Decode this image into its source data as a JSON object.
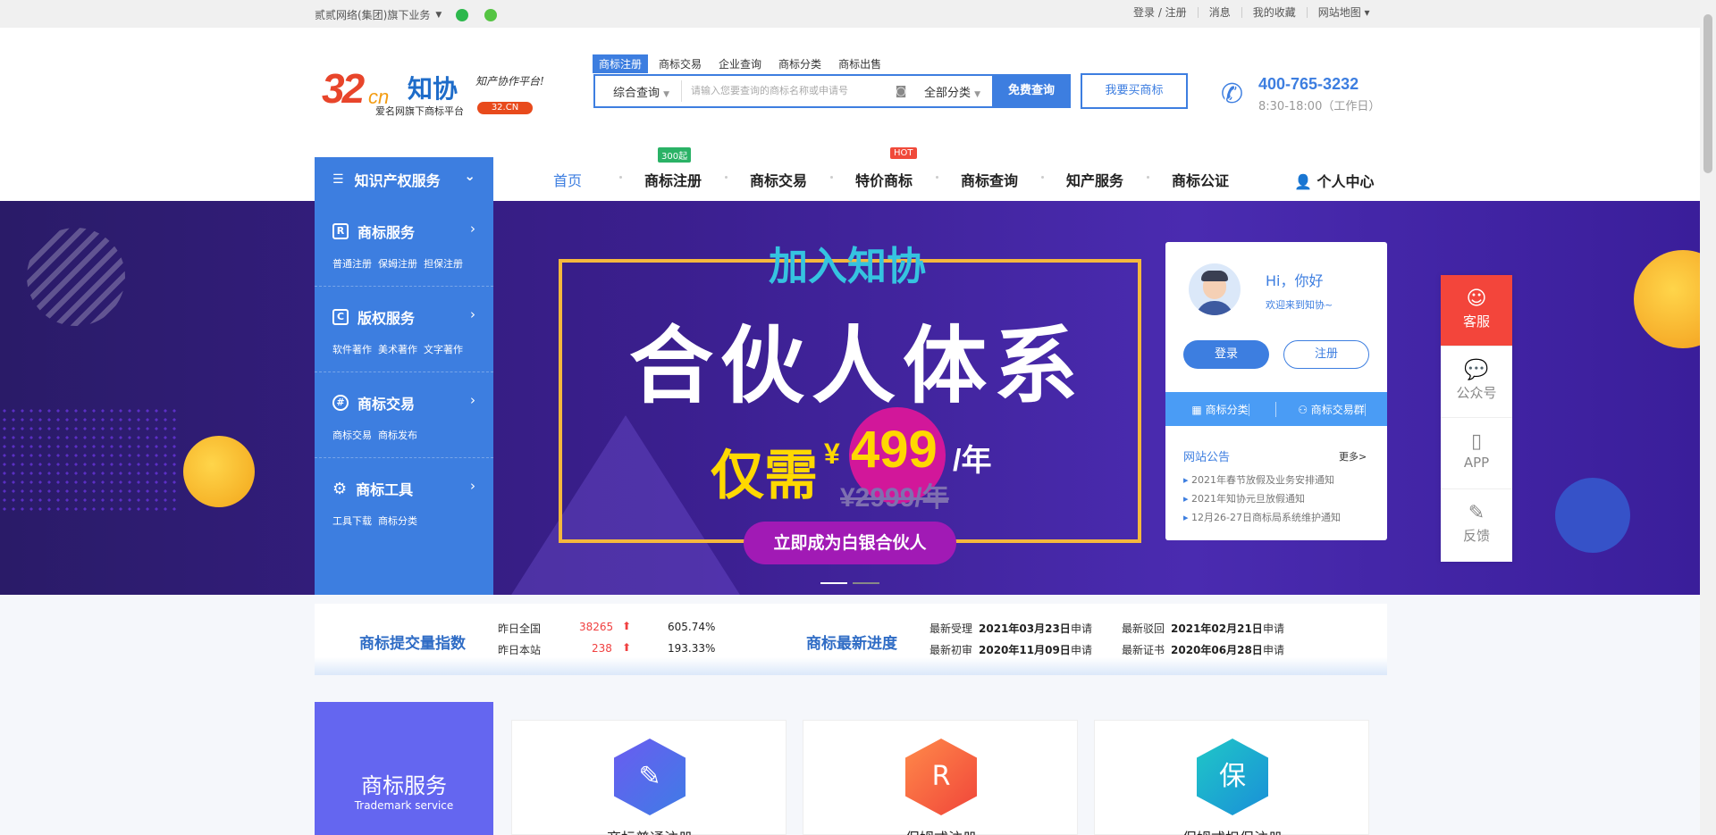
{
  "topbar": {
    "group": "贰贰网络(集团)旗下业务",
    "login": "登录 / 注册",
    "messages": "消息",
    "favorites": "我的收藏",
    "sitemap": "网站地图"
  },
  "logo": {
    "num": "32",
    "cn": "cn",
    "name": "知协",
    "sub": "爱名网旗下商标平台",
    "slogan": "知产协作平台!",
    "tag": "32.CN"
  },
  "search": {
    "tabs": [
      "商标注册",
      "商标交易",
      "企业查询",
      "商标分类",
      "商标出售"
    ],
    "select1": "综合查询",
    "placeholder": "请输入您要查询的商标名称或申请号",
    "select2": "全部分类",
    "button": "免费查询"
  },
  "buy_button": "我要买商标",
  "contact": {
    "phone": "400-765-3232",
    "hours": "8:30-18:00（工作日）"
  },
  "nav": {
    "side_title": "知识产权服务",
    "items": [
      "首页",
      "商标注册",
      "商标交易",
      "特价商标",
      "商标查询",
      "知产服务",
      "商标公证"
    ],
    "badge_300": "300起",
    "badge_hot": "HOT",
    "user_center": "个人中心"
  },
  "side_menu": [
    {
      "title": "商标服务",
      "icon": "R",
      "links": [
        "普通注册",
        "保姆注册",
        "担保注册"
      ]
    },
    {
      "title": "版权服务",
      "icon": "C",
      "links": [
        "软件著作",
        "美术著作",
        "文字著作"
      ]
    },
    {
      "title": "商标交易",
      "icon": "#",
      "links": [
        "商标交易",
        "商标发布"
      ]
    },
    {
      "title": "商标工具",
      "icon": "gear-icon",
      "links": [
        "工具下载",
        "商标分类"
      ]
    }
  ],
  "banner": {
    "line1": "加入知协",
    "line2": "合伙人体系",
    "line3": "仅需",
    "yen": "¥",
    "price": "499",
    "per_year": "/年",
    "old_price": "¥2999/年",
    "cta": "立即成为白银合伙人"
  },
  "user_card": {
    "hi": "Hi，你好",
    "welcome": "欢迎来到知协~",
    "login": "登录",
    "register": "注册",
    "bar": [
      "商标分类",
      "商标交易群"
    ],
    "notice_title": "网站公告",
    "more": "更多>",
    "notices": [
      "2021年春节放假及业务安排通知",
      "2021年知协元旦放假通知",
      "12月26-27日商标局系统维护通知"
    ]
  },
  "float_tools": [
    "客服",
    "公众号",
    "APP",
    "反馈"
  ],
  "stats": {
    "index_title": "商标提交量指数",
    "yesterday_all": "昨日全国",
    "all_count": "38265",
    "all_pct": "605.74%",
    "yesterday_site": "昨日本站",
    "site_count": "238",
    "site_pct": "193.33%",
    "progress_title": "商标最新进度",
    "accept_label": "最新受理",
    "accept_date": "2021年03月23日",
    "apply": "申请",
    "reject_label": "最新驳回",
    "reject_date": "2021年02月21日",
    "trial_label": "最新初审",
    "trial_date": "2020年11月09日",
    "cert_label": "最新证书",
    "cert_date": "2020年06月28日"
  },
  "services": {
    "title": "商标服务",
    "subtitle": "Trademark service",
    "cards": [
      "商标普通注册",
      "保姆式注册",
      "保姆式担保注册"
    ],
    "card_icons": [
      "",
      "R",
      "保"
    ]
  },
  "colors": {
    "accent": "#3d7ee0",
    "banner": "#3b1f8f",
    "red": "#f3453b",
    "service": "#6466f0"
  }
}
